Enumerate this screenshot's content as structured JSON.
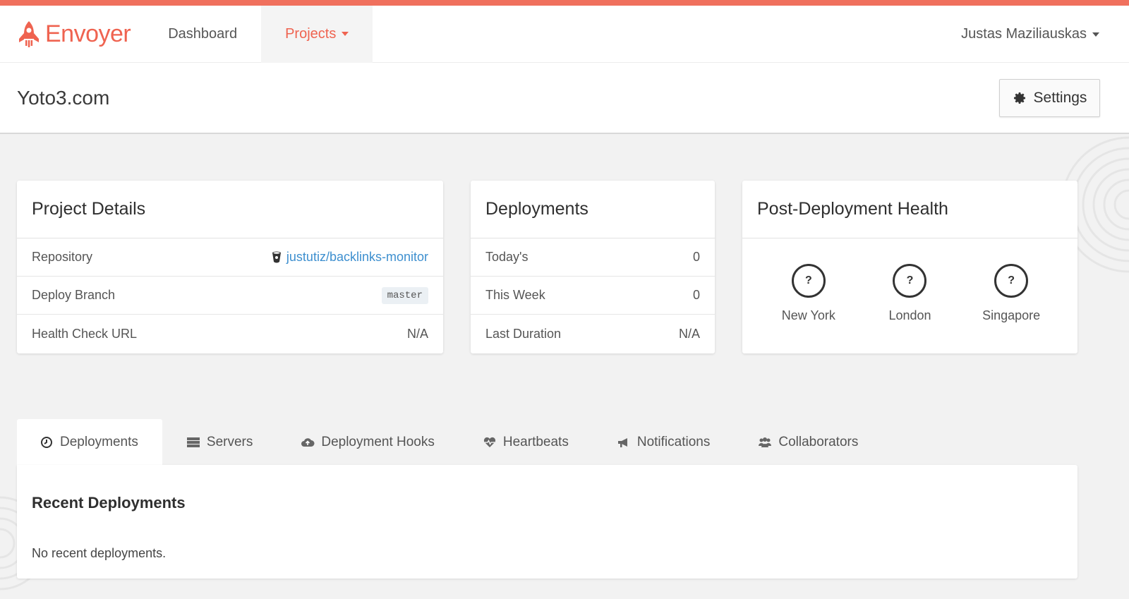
{
  "brand": {
    "name": "Envoyer",
    "accent": "#ef6350"
  },
  "nav": {
    "items": [
      {
        "label": "Dashboard",
        "active": false
      },
      {
        "label": "Projects",
        "active": true
      }
    ],
    "user": "Justas Maziliauskas"
  },
  "header": {
    "title": "Yoto3.com",
    "settings_label": "Settings"
  },
  "project_details": {
    "title": "Project Details",
    "rows": [
      {
        "label": "Repository",
        "value": "justutiz/backlinks-monitor"
      },
      {
        "label": "Deploy Branch",
        "value": "master"
      },
      {
        "label": "Health Check URL",
        "value": "N/A"
      }
    ]
  },
  "deployments": {
    "title": "Deployments",
    "rows": [
      {
        "label": "Today's",
        "value": "0"
      },
      {
        "label": "This Week",
        "value": "0"
      },
      {
        "label": "Last Duration",
        "value": "N/A"
      }
    ]
  },
  "health": {
    "title": "Post-Deployment Health",
    "locations": [
      {
        "symbol": "?",
        "name": "New York"
      },
      {
        "symbol": "?",
        "name": "London"
      },
      {
        "symbol": "?",
        "name": "Singapore"
      }
    ]
  },
  "tabs": [
    {
      "label": "Deployments",
      "icon": "clock-icon",
      "active": true
    },
    {
      "label": "Servers",
      "icon": "server-icon",
      "active": false
    },
    {
      "label": "Deployment Hooks",
      "icon": "cloud-upload-icon",
      "active": false
    },
    {
      "label": "Heartbeats",
      "icon": "heartbeat-icon",
      "active": false
    },
    {
      "label": "Notifications",
      "icon": "bullhorn-icon",
      "active": false
    },
    {
      "label": "Collaborators",
      "icon": "users-icon",
      "active": false
    }
  ],
  "recent": {
    "title": "Recent Deployments",
    "empty": "No recent deployments."
  }
}
